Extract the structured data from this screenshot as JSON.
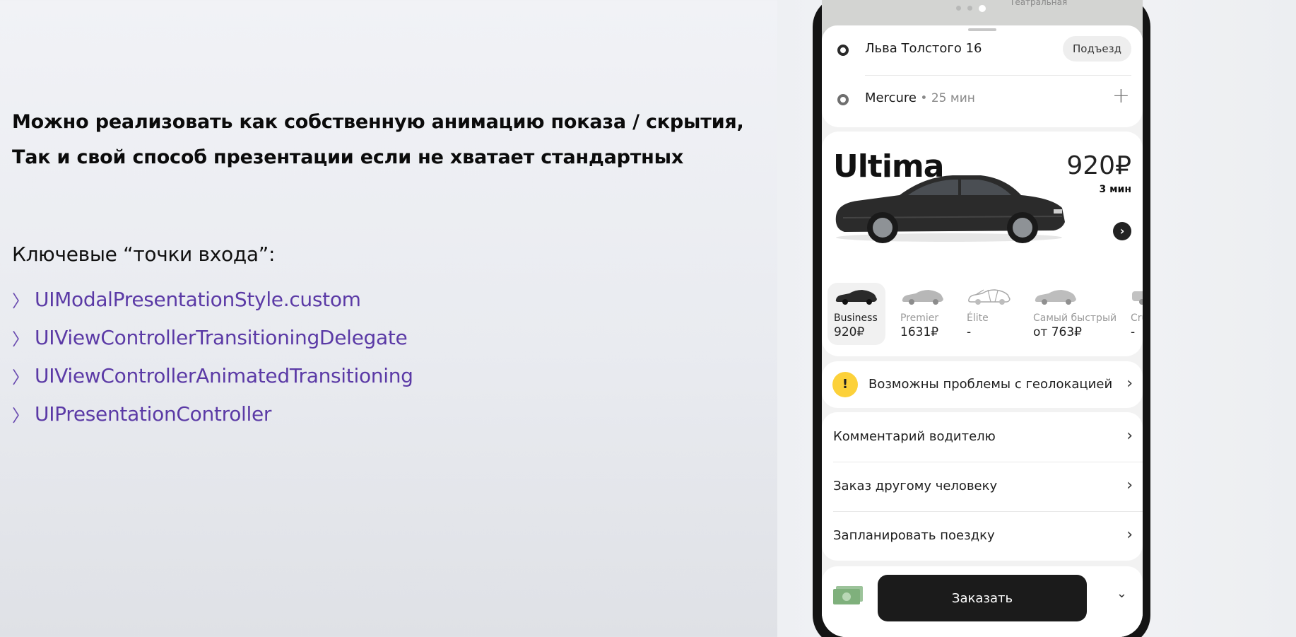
{
  "slide": {
    "heading_line1": "Можно реализовать как собственную анимацию показа / скрытия,",
    "heading_line2": "Так и свой способ презентации если не хватает стандартных",
    "entry_title": "Ключевые “точки входа”:",
    "entry_points": [
      "UIModalPresentationStyle.custom",
      "UIViewControllerTransitioningDelegate",
      "UIViewControllerAnimatedTransitioning",
      "UIPresentationController"
    ],
    "bullet_glyph": "〉",
    "accent_color": "#5b3aa6"
  },
  "app": {
    "map_label": "Театральная",
    "route": {
      "from": "Льва Толстого 16",
      "entrance_button": "Подъезд",
      "to": "Mercure",
      "to_eta": " • 25 мин"
    },
    "tariff": {
      "name": "Ultima",
      "price": "920₽",
      "eta": "3 мин",
      "tiers": [
        {
          "name": "Business",
          "price": "920₽",
          "selected": true
        },
        {
          "name": "Premier",
          "price": "1631₽",
          "selected": false
        },
        {
          "name": "Élite",
          "price": "-",
          "selected": false
        },
        {
          "name": "Самый быстрый",
          "price": "от 763₽",
          "selected": false
        },
        {
          "name": "Cru",
          "price": "-",
          "selected": false
        }
      ]
    },
    "geo_warning": "Возможны проблемы с геолокацией",
    "menu": {
      "comment": "Комментарий водителю",
      "other_person": "Заказ другому человеку",
      "schedule": "Запланировать поездку"
    },
    "order_button": "Заказать",
    "icons": {
      "warning": "warning-icon",
      "cash": "cash-icon",
      "chevron": "chevron-right-icon"
    }
  }
}
